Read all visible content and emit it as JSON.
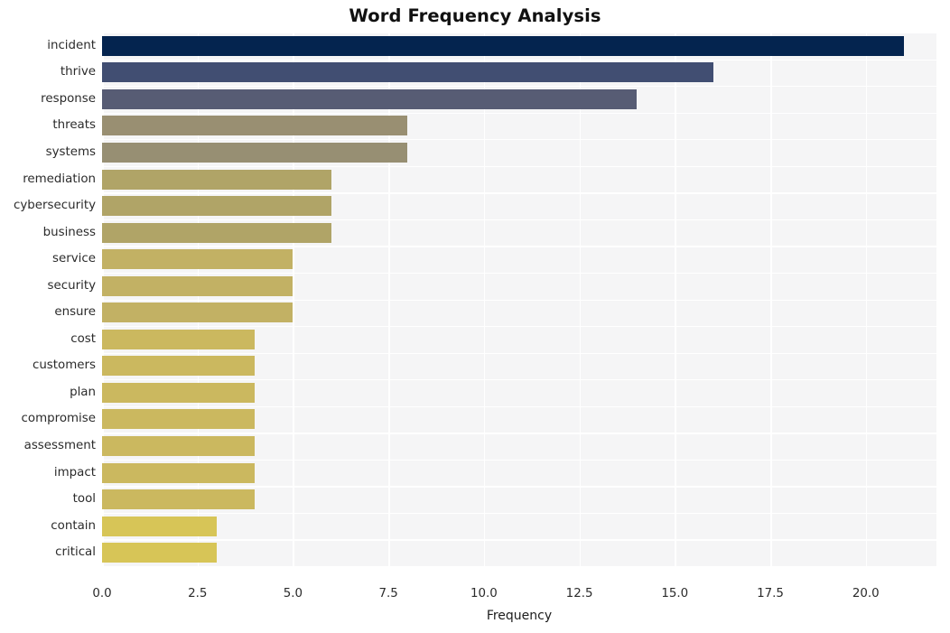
{
  "chart_data": {
    "type": "bar",
    "orientation": "horizontal",
    "title": "Word Frequency Analysis",
    "xlabel": "Frequency",
    "ylabel": "",
    "xlim": [
      0,
      21.85
    ],
    "xticks": [
      "0.0",
      "2.5",
      "5.0",
      "7.5",
      "10.0",
      "12.5",
      "15.0",
      "17.5",
      "20.0"
    ],
    "xtick_values": [
      0,
      2.5,
      5,
      7.5,
      10,
      12.5,
      15,
      17.5,
      20
    ],
    "grid": true,
    "legend": "none",
    "categories": [
      "incident",
      "thrive",
      "response",
      "threats",
      "systems",
      "remediation",
      "cybersecurity",
      "business",
      "service",
      "security",
      "ensure",
      "cost",
      "customers",
      "plan",
      "compromise",
      "assessment",
      "impact",
      "tool",
      "contain",
      "critical"
    ],
    "values": [
      21,
      16,
      14,
      8,
      8,
      6,
      6,
      6,
      5,
      5,
      5,
      4,
      4,
      4,
      4,
      4,
      4,
      4,
      3,
      3
    ],
    "bar_colors": [
      "#04244f",
      "#414e72",
      "#575c74",
      "#998f72",
      "#978f73",
      "#b0a467",
      "#b0a467",
      "#b0a467",
      "#c2b164",
      "#c2b164",
      "#c2b164",
      "#cbb85f",
      "#cbb85f",
      "#cbb85f",
      "#cbb85f",
      "#cbb85f",
      "#cbb85f",
      "#cbb85f",
      "#d7c557",
      "#d7c557"
    ],
    "plot_background": "#f5f5f6",
    "gridline_color": "#ffffff",
    "figure_background": "#ffffff"
  }
}
